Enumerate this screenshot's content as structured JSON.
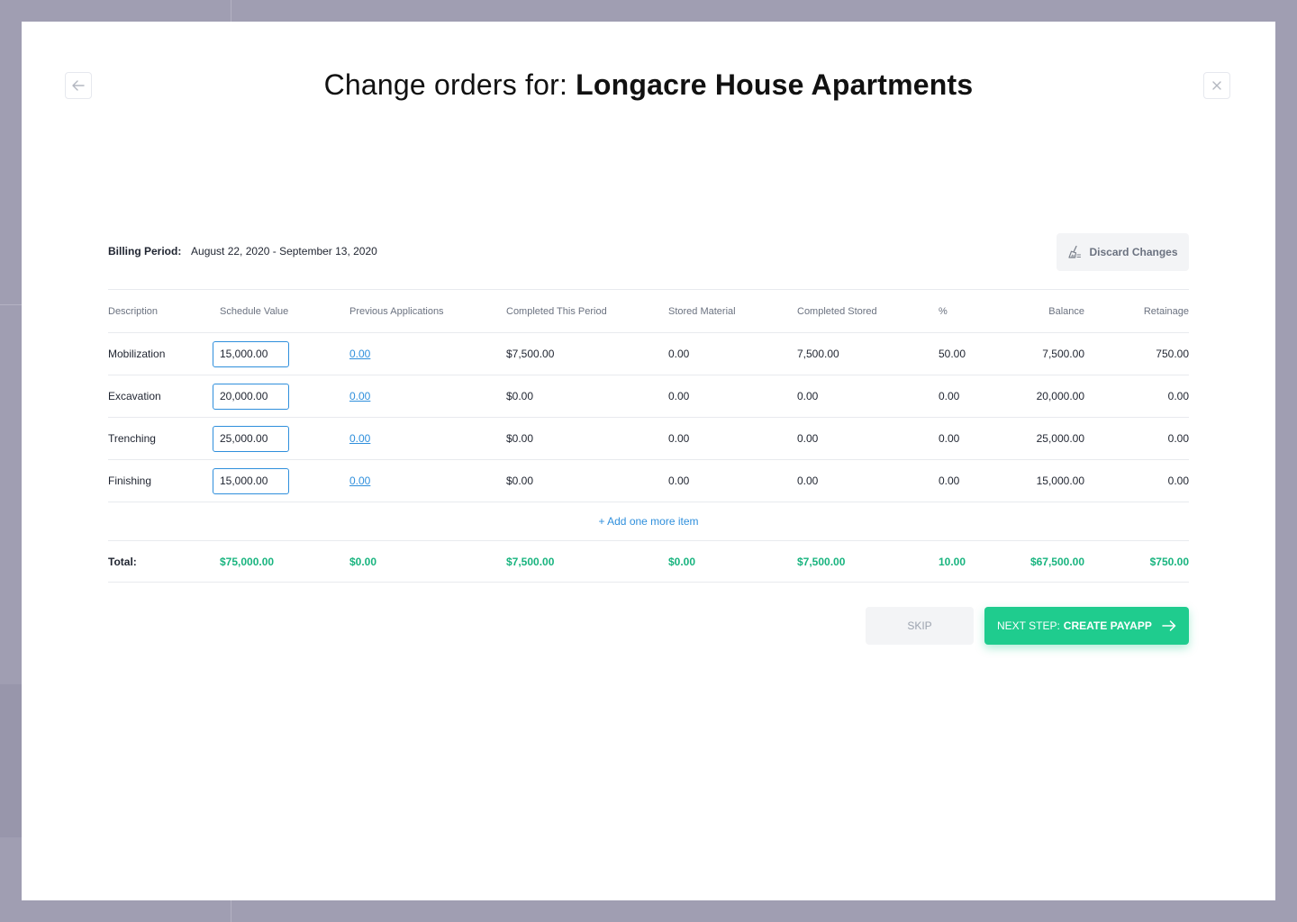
{
  "header": {
    "title_prefix": "Change orders for:",
    "project_name": "Longacre House Apartments"
  },
  "billing": {
    "label": "Billing Period:",
    "period": "August 22, 2020 - September 13, 2020"
  },
  "actions": {
    "discard_label": "Discard Changes",
    "skip_label": "SKIP",
    "next_prefix": "NEXT STEP:",
    "next_label": "CREATE PAYAPP",
    "add_item_label": "+ Add one more item"
  },
  "table": {
    "columns": [
      "Description",
      "Schedule Value",
      "Previous Applications",
      "Completed This Period",
      "Stored Material",
      "Completed Stored",
      "%",
      "Balance",
      "Retainage"
    ],
    "rows": [
      {
        "description": "Mobilization",
        "schedule_value": "15,000.00",
        "previous": "0.00",
        "completed_period": "$7,500.00",
        "stored_material": "0.00",
        "completed_stored": "7,500.00",
        "percent": "50.00",
        "balance": "7,500.00",
        "retainage": "750.00"
      },
      {
        "description": "Excavation",
        "schedule_value": "20,000.00",
        "previous": "0.00",
        "completed_period": "$0.00",
        "stored_material": "0.00",
        "completed_stored": "0.00",
        "percent": "0.00",
        "balance": "20,000.00",
        "retainage": "0.00"
      },
      {
        "description": "Trenching",
        "schedule_value": "25,000.00",
        "previous": "0.00",
        "completed_period": "$0.00",
        "stored_material": "0.00",
        "completed_stored": "0.00",
        "percent": "0.00",
        "balance": "25,000.00",
        "retainage": "0.00"
      },
      {
        "description": "Finishing",
        "schedule_value": "15,000.00",
        "previous": "0.00",
        "completed_period": "$0.00",
        "stored_material": "0.00",
        "completed_stored": "0.00",
        "percent": "0.00",
        "balance": "15,000.00",
        "retainage": "0.00"
      }
    ],
    "totals": {
      "label": "Total:",
      "schedule_value": "$75,000.00",
      "previous": "$0.00",
      "completed_period": "$7,500.00",
      "stored_material": "$0.00",
      "completed_stored": "$7,500.00",
      "percent": "10.00",
      "balance": "$67,500.00",
      "retainage": "$750.00"
    }
  },
  "colors": {
    "accent_green": "#1fcc8e",
    "total_green": "#19b47f",
    "link_blue": "#2f8fdc",
    "backdrop": "#a09eb2"
  },
  "icons": {
    "back": "arrow-left-icon",
    "close": "close-icon",
    "discard": "broom-icon",
    "next": "arrow-right-icon"
  }
}
